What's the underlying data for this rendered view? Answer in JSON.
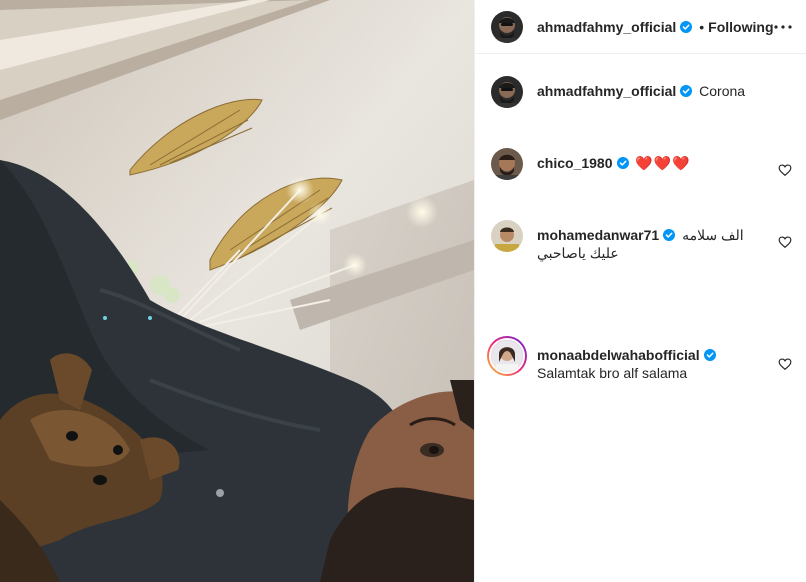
{
  "post": {
    "author": "ahmadfahmy_official",
    "follow_status": "Following",
    "separator": "•"
  },
  "caption": {
    "username": "ahmadfahmy_official",
    "text": "Corona"
  },
  "comments": [
    {
      "username": "chico_1980",
      "text": "❤️❤️❤️",
      "verified": true
    },
    {
      "username": "mohamedanwar71",
      "text_line1": "الف سلامه",
      "text_line2": "عليك ياصاحبي",
      "verified": true
    },
    {
      "username": "monaabdelwahabofficial",
      "text": "Salamtak bro alf salama",
      "verified": true
    }
  ],
  "icons": {
    "more": "more-horizontal-icon",
    "like": "heart-outline-icon",
    "verified": "verified-badge-icon"
  },
  "colors": {
    "verified_blue": "#0095f6",
    "text": "#262626",
    "story_ring": [
      "#f9ce34",
      "#ee2a7b",
      "#6228d7"
    ]
  }
}
